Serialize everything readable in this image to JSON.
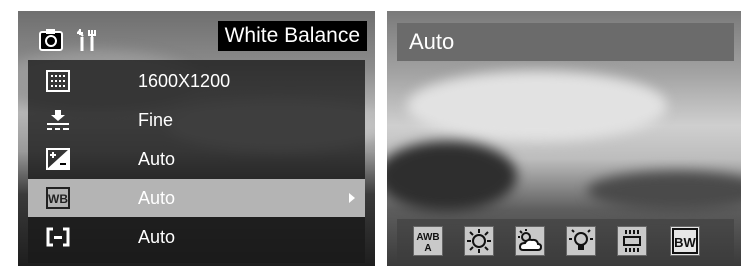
{
  "left": {
    "title": "White Balance",
    "tabs": [
      {
        "icon": "camera-icon"
      },
      {
        "icon": "setup-icon"
      }
    ],
    "menu": [
      {
        "icon": "resolution-icon",
        "value": "1600X1200"
      },
      {
        "icon": "quality-icon",
        "value": "Fine"
      },
      {
        "icon": "exposure-icon",
        "value": "Auto"
      },
      {
        "icon": "white-balance-icon",
        "value": "Auto",
        "selected": true
      },
      {
        "icon": "metering-icon",
        "value": "Auto"
      }
    ]
  },
  "right": {
    "title": "Auto",
    "options": [
      {
        "icon": "awb-auto-icon",
        "label": "AWB"
      },
      {
        "icon": "daylight-icon"
      },
      {
        "icon": "cloudy-icon"
      },
      {
        "icon": "tungsten-icon"
      },
      {
        "icon": "fluorescent-icon"
      },
      {
        "icon": "black-white-icon",
        "label": "BW"
      }
    ]
  },
  "colors": {
    "title_bg": "#000000",
    "selected_row": "#b4b4b4",
    "menu_bg": "#191919",
    "right_title_bg": "#6b6b6b"
  }
}
